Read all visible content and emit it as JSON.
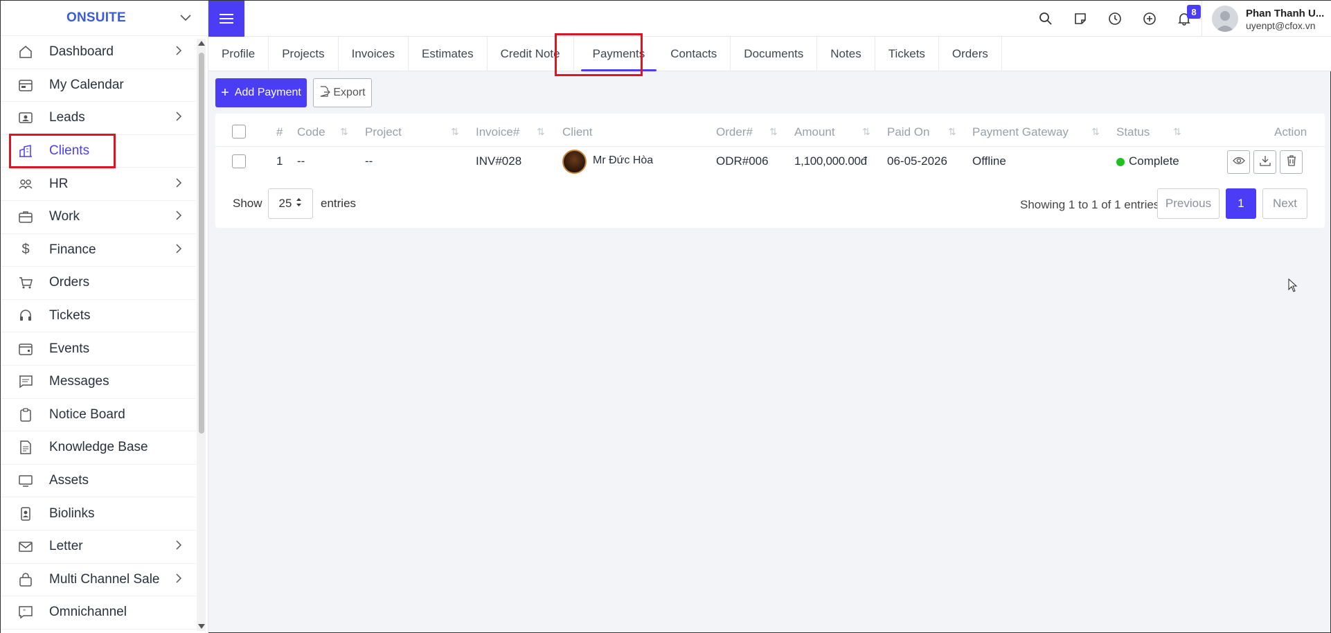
{
  "brand": {
    "name": "ONSUITE"
  },
  "sidebar": {
    "items": [
      {
        "label": "Dashboard",
        "icon": "home-icon",
        "has_submenu": true
      },
      {
        "label": "My Calendar",
        "icon": "calendar-icon",
        "has_submenu": false
      },
      {
        "label": "Leads",
        "icon": "id-card-icon",
        "has_submenu": true
      },
      {
        "label": "Clients",
        "icon": "building-icon",
        "has_submenu": false,
        "active": true
      },
      {
        "label": "HR",
        "icon": "people-icon",
        "has_submenu": true
      },
      {
        "label": "Work",
        "icon": "briefcase-icon",
        "has_submenu": true
      },
      {
        "label": "Finance",
        "icon": "dollar-icon",
        "has_submenu": true
      },
      {
        "label": "Orders",
        "icon": "cart-icon",
        "has_submenu": false
      },
      {
        "label": "Tickets",
        "icon": "headset-icon",
        "has_submenu": false
      },
      {
        "label": "Events",
        "icon": "calendar-event-icon",
        "has_submenu": false
      },
      {
        "label": "Messages",
        "icon": "message-icon",
        "has_submenu": false
      },
      {
        "label": "Notice Board",
        "icon": "clipboard-icon",
        "has_submenu": false
      },
      {
        "label": "Knowledge Base",
        "icon": "document-icon",
        "has_submenu": false
      },
      {
        "label": "Assets",
        "icon": "monitor-icon",
        "has_submenu": false
      },
      {
        "label": "Biolinks",
        "icon": "badge-icon",
        "has_submenu": false
      },
      {
        "label": "Letter",
        "icon": "envelope-icon",
        "has_submenu": true
      },
      {
        "label": "Multi Channel Sale",
        "icon": "bag-icon",
        "has_submenu": true
      },
      {
        "label": "Omnichannel",
        "icon": "chat-quote-icon",
        "has_submenu": false
      }
    ]
  },
  "header": {
    "notification_count": "8",
    "user_name": "Phan Thanh U...",
    "user_email": "uyenpt@cfox.vn"
  },
  "tabs": [
    {
      "label": "Profile"
    },
    {
      "label": "Projects"
    },
    {
      "label": "Invoices"
    },
    {
      "label": "Estimates"
    },
    {
      "label": "Credit Note"
    },
    {
      "label": "Payments",
      "active": true
    },
    {
      "label": "Contacts"
    },
    {
      "label": "Documents"
    },
    {
      "label": "Notes"
    },
    {
      "label": "Tickets"
    },
    {
      "label": "Orders"
    }
  ],
  "actions": {
    "add_payment": "Add Payment",
    "export": "Export"
  },
  "table": {
    "columns": [
      "#",
      "Code",
      "Project",
      "Invoice#",
      "Client",
      "Order#",
      "Amount",
      "Paid On",
      "Payment Gateway",
      "Status",
      "Action"
    ],
    "rows": [
      {
        "num": "1",
        "code": "--",
        "project": "--",
        "invoice": "INV#028",
        "client": "Mr Đức Hòa",
        "order": "ODR#006",
        "amount": "1,100,000.00đ",
        "paid_on": "06-05-2026",
        "gateway": "Offline",
        "status": "Complete"
      }
    ]
  },
  "pagination": {
    "show_label": "Show",
    "page_size": "25",
    "entries_label": "entries",
    "summary": "Showing 1 to 1 of 1 entries",
    "previous": "Previous",
    "current_page": "1",
    "next": "Next"
  },
  "colors": {
    "accent": "#4a3df5",
    "highlight_box": "#e0141e",
    "status_complete": "#20c020"
  }
}
